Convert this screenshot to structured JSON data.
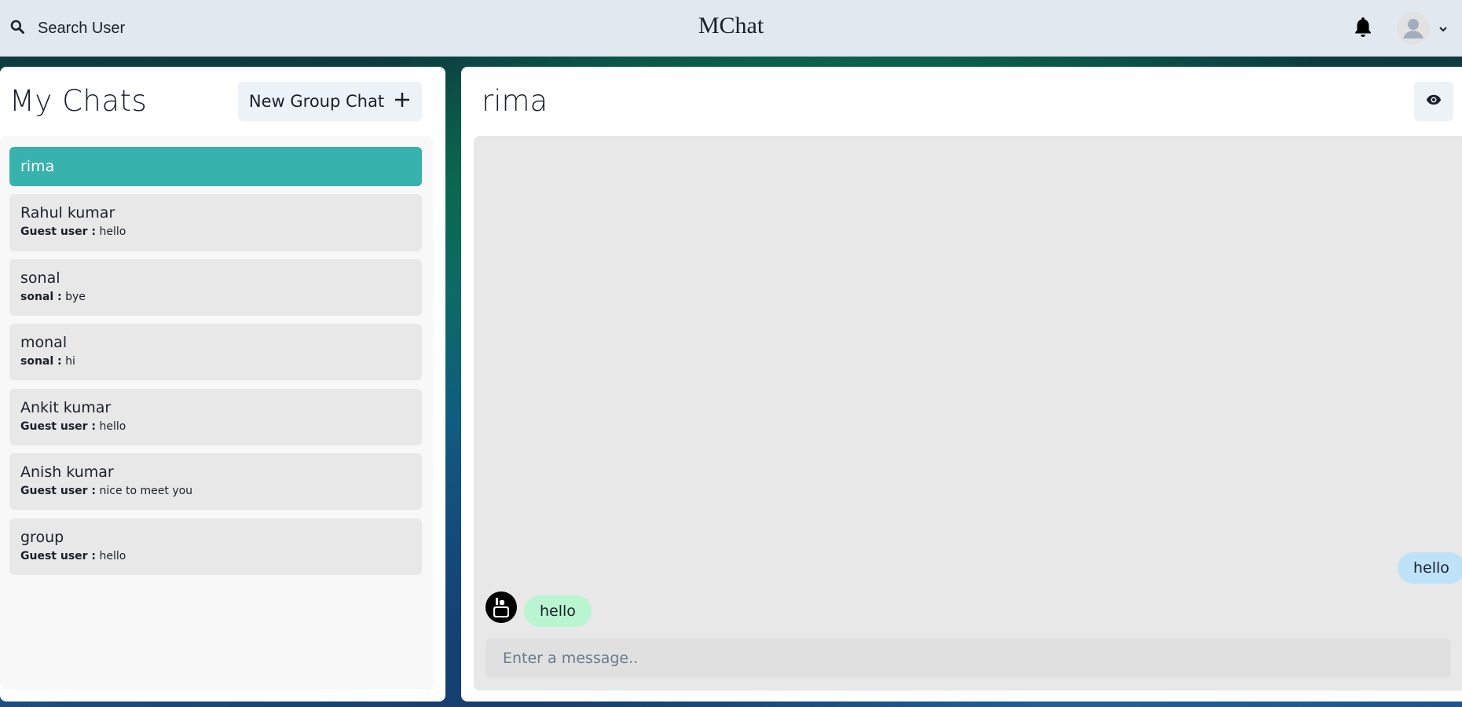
{
  "header": {
    "search_label": "Search User",
    "app_title": "MChat"
  },
  "sidebar": {
    "title": "My Chats",
    "new_group_label": "New Group Chat",
    "chats": [
      {
        "name": "rima",
        "sender": "",
        "message": "",
        "active": true
      },
      {
        "name": "Rahul kumar",
        "sender": "Guest user :",
        "message": "hello"
      },
      {
        "name": "sonal",
        "sender": "sonal :",
        "message": "bye"
      },
      {
        "name": "monal",
        "sender": "sonal :",
        "message": "hi"
      },
      {
        "name": "Ankit kumar",
        "sender": "Guest user :",
        "message": "hello"
      },
      {
        "name": "Anish kumar",
        "sender": "Guest user :",
        "message": "nice to meet you"
      },
      {
        "name": "group",
        "sender": "Guest user :",
        "message": "hello"
      }
    ]
  },
  "chat": {
    "title": "rima",
    "messages": [
      {
        "text": "hello",
        "from": "me"
      },
      {
        "text": "hello",
        "from": "other"
      }
    ],
    "input_placeholder": "Enter a message..",
    "input_value": ""
  },
  "colors": {
    "accent": "#38b2ac",
    "topbar_bg": "#e2e8f0",
    "my_bubble": "#bee3f8",
    "their_bubble": "#b9f5d0"
  },
  "icons": {
    "search": "search-icon",
    "bell": "bell-icon",
    "avatar": "user-avatar-icon",
    "chevron": "chevron-down-icon",
    "add": "plus-icon",
    "view": "eye-icon"
  }
}
